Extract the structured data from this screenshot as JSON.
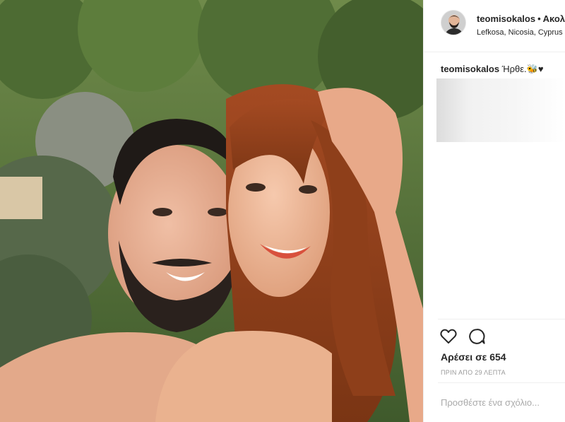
{
  "post": {
    "username": "teomisokalos",
    "dot": "•",
    "follow_label": "Ακολουθήστε",
    "location": "Lefkosa, Nicosia, Cyprus",
    "caption_user": "teomisokalos",
    "caption_text": "Ήρθε.🐝♥",
    "likes": "Αρέσει σε 654",
    "time_ago": "ΠΡΙΝ ΑΠΟ 29 ΛΕΠΤΑ",
    "comment_placeholder": "Προσθέστε ένα σχόλιο..."
  },
  "icons": {
    "like": "heart-outline-icon",
    "comment": "speech-bubble-icon"
  },
  "colors": {
    "text": "#262626",
    "muted": "#999999",
    "divider": "#efefef"
  }
}
